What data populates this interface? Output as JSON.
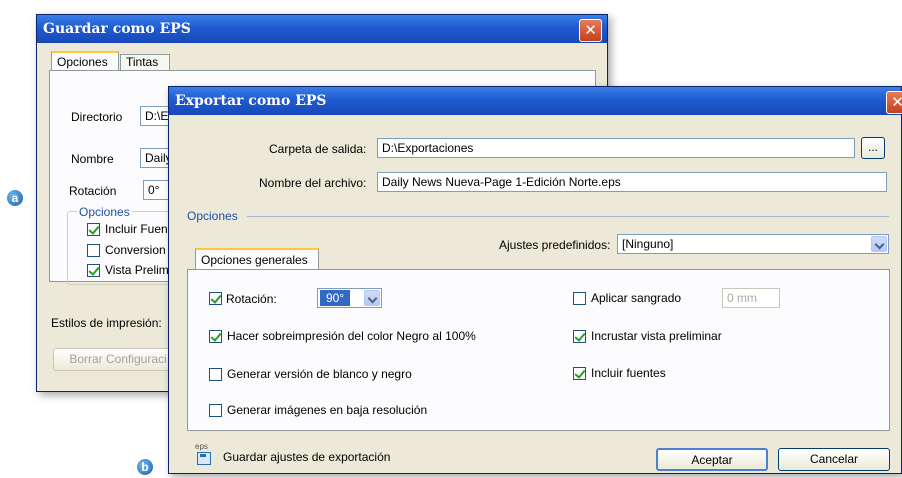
{
  "badges": {
    "a": "a",
    "b": "b"
  },
  "back_window": {
    "title": "Guardar como EPS",
    "close": "✕",
    "tabs": [
      "Opciones",
      "Tintas"
    ],
    "directorio_label": "Directorio",
    "directorio_value": "D:\\E",
    "nombre_label": "Nombre",
    "nombre_value": "Daily",
    "rotacion_label": "Rotación",
    "rotacion_value": "0°",
    "opciones_group": "Opciones",
    "options": [
      "Incluir Fuen",
      "Conversion",
      "Vista Prelim"
    ],
    "options_checked": [
      true,
      false,
      true
    ],
    "estilos_label": "Estilos de impresión:",
    "borrar_button": "Borrar Configuraci"
  },
  "front_window": {
    "title": "Exportar como EPS",
    "close": "✕",
    "carpeta_label": "Carpeta de salida:",
    "carpeta_value": "D:\\Exportaciones",
    "browse_button": "...",
    "nombre_label": "Nombre del archivo:",
    "nombre_value": "Daily News Nueva-Page 1-Edición Norte.eps",
    "opciones_group": "Opciones",
    "ajustes_label": "Ajustes predefinidos:",
    "ajustes_value": "[Ninguno]",
    "tab_general": "Opciones generales",
    "rotacion_label": "Rotación:",
    "rotacion_value": "90°",
    "rotacion_checked": true,
    "sobreimpresion_label": "Hacer sobreimpresión del color Negro al 100%",
    "sobreimpresion_checked": true,
    "blanco_negro_label": "Generar versión de blanco y negro",
    "blanco_negro_checked": false,
    "baja_res_label": "Generar imágenes en baja resolución",
    "baja_res_checked": false,
    "sangrado_label": "Aplicar sangrado",
    "sangrado_checked": false,
    "sangrado_value": "0 mm",
    "vista_label": "Incrustar vista preliminar",
    "vista_checked": true,
    "fuentes_label": "Incluir fuentes",
    "fuentes_checked": true,
    "save_settings_icon_text": "eps",
    "save_settings_label": "Guardar ajustes de exportación",
    "accept_button": "Aceptar",
    "cancel_button": "Cancelar"
  }
}
